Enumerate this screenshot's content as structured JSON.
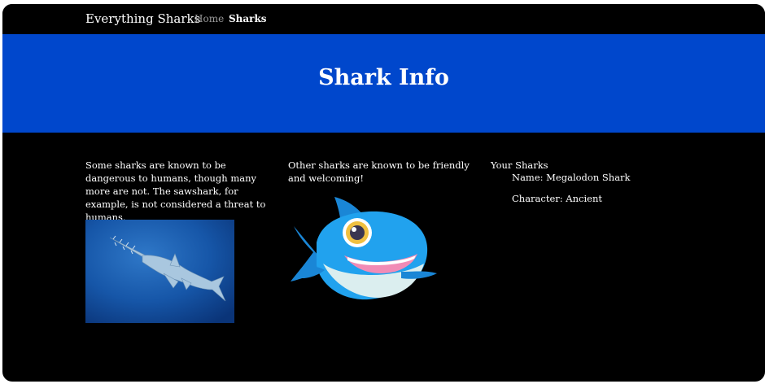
{
  "nav": {
    "brand": "Everything Sharks",
    "links": [
      "Home",
      "Sharks"
    ]
  },
  "hero": {
    "title": "Shark Info"
  },
  "columns": {
    "left_text": "Some sharks are known to be dangerous to humans, though many more are not. The sawshark, for example, is not considered a threat to humans.",
    "middle_text": "Other sharks are known to be friendly and welcoming!",
    "right_heading": "Your Sharks"
  },
  "your_sharks": [
    {
      "name_line": "Name: Megalodon Shark",
      "character_line": "Character: Ancient"
    }
  ],
  "colors": {
    "page_background": "#000000",
    "hero_background": "#0047cc",
    "text": "#ffffff",
    "inactive_link": "#9a9a9a"
  },
  "icons": {
    "photo": "sawshark-photo",
    "cartoon": "cartoon-shark-image"
  }
}
